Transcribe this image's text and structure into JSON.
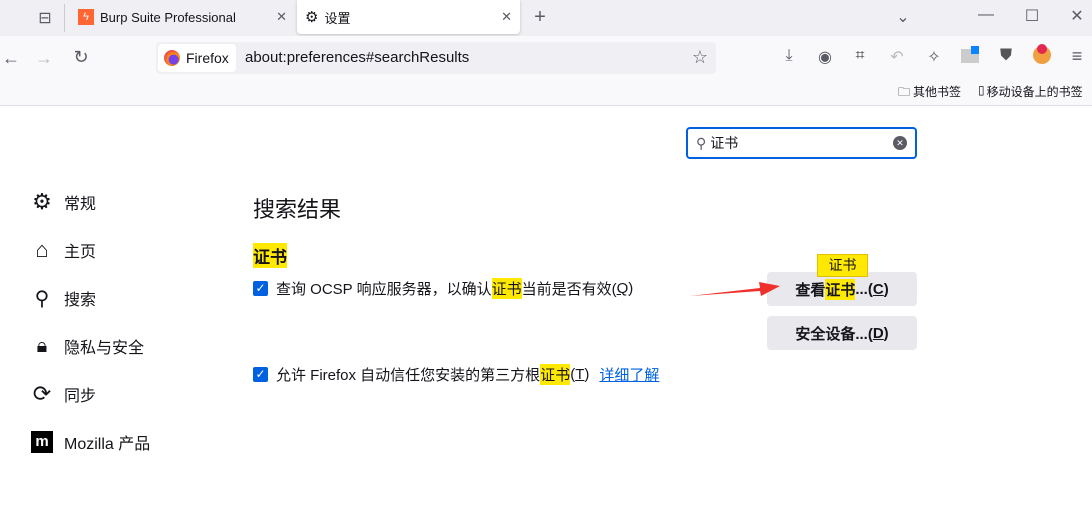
{
  "tabs": [
    {
      "title": "Burp Suite Professional",
      "icon": "burp-icon"
    },
    {
      "title": "设置",
      "icon": "gear-icon"
    }
  ],
  "nav": {
    "identity": "Firefox",
    "url": "about:preferences#searchResults"
  },
  "bookmarks": [
    {
      "label": "其他书签",
      "icon": "folder-icon"
    },
    {
      "label": "移动设备上的书签",
      "icon": "mobile-icon"
    }
  ],
  "search": {
    "value": "证书"
  },
  "sidebar": [
    {
      "label": "常规",
      "icon": "gear-icon"
    },
    {
      "label": "主页",
      "icon": "home-icon"
    },
    {
      "label": "搜索",
      "icon": "search-icon"
    },
    {
      "label": "隐私与安全",
      "icon": "lock-icon"
    },
    {
      "label": "同步",
      "icon": "sync-icon"
    },
    {
      "label": "Mozilla 产品",
      "icon": "mozilla-icon"
    }
  ],
  "main": {
    "title": "搜索结果",
    "section": "证书",
    "ocsp": {
      "pre": "查询 OCSP 响应服务器，以确认",
      "hl": "证书",
      "post": "当前是否有效(",
      "key": "Q",
      "end": ")",
      "checked": true
    },
    "thirdparty": {
      "pre": "允许 Firefox 自动信任您安装的第三方根",
      "hl": "证书",
      "post": "(",
      "key": "T",
      "end": ")",
      "checked": true,
      "link": "详细了解"
    },
    "view_btn": {
      "pre": "查看",
      "hl": "证书",
      "post": "...(",
      "key": "C",
      "end": ")"
    },
    "device_btn": {
      "pre": "安全设备...(",
      "key": "D",
      "end": ")"
    },
    "tooltip": "证书"
  },
  "colors": {
    "accent": "#0061e0",
    "highlight": "#ffe900",
    "arrow": "#f0302c"
  }
}
